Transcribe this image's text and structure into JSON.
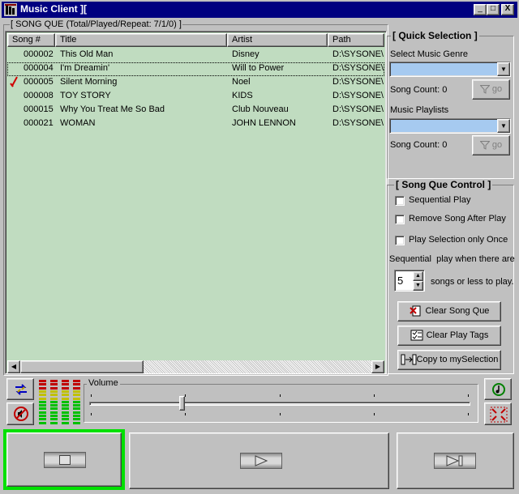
{
  "window": {
    "title": "Music Client ][",
    "controls": {
      "minimize": "_",
      "maximize": "□",
      "close": "X"
    }
  },
  "queue": {
    "legend": "[ SONG QUE (Total/Played/Repeat: 7/1/0) ]",
    "columns": [
      "Song #",
      "Title",
      "Artist",
      "Path"
    ],
    "rows": [
      {
        "num": "000002",
        "title": "This Old Man",
        "artist": "Disney",
        "path": "D:\\SYSONE\\"
      },
      {
        "num": "000004",
        "title": "I'm Dreamin'",
        "artist": "Will to Power",
        "path": "D:\\SYSONE\\"
      },
      {
        "num": "000005",
        "title": "Silent Morning",
        "artist": "Noel",
        "path": "D:\\SYSONE\\"
      },
      {
        "num": "000008",
        "title": "TOY STORY",
        "artist": "KIDS",
        "path": "D:\\SYSONE\\"
      },
      {
        "num": "000015",
        "title": "Why You Treat Me So Bad",
        "artist": "Club Nouveau",
        "path": "D:\\SYSONE\\"
      },
      {
        "num": "000021",
        "title": "WOMAN",
        "artist": "JOHN LENNON",
        "path": "D:\\SYSONE\\"
      }
    ],
    "playing_row": 2,
    "focused_row": 1
  },
  "quick_selection": {
    "legend": "[ Quick Selection ]",
    "genre_label": "Select Music Genre",
    "genre_value": "",
    "genre_count": "Song Count: 0",
    "playlists_label": "Music Playlists",
    "playlist_value": "",
    "playlist_count": "Song Count: 0",
    "go_label": "go"
  },
  "que_control": {
    "legend": "[ Song Que Control ]",
    "sequential_play": "Sequential Play",
    "remove_after_play": "Remove Song After Play",
    "play_once": "Play Selection only Once",
    "seq_text_1": "Sequential  play when there are",
    "seq_value": "5",
    "seq_text_2": "songs or less to play.",
    "clear_que": "Clear Song Que",
    "clear_tags": "Clear Play Tags",
    "copy_selection": "Copy to mySelection"
  },
  "volume": {
    "label": "Volume",
    "level": 0.24
  },
  "colors": {
    "titlebar": "#000080",
    "queue_bg": "#c0dcc0",
    "combo_bg": "#a6caf0",
    "vu_green": "#00c000",
    "vu_yellow": "#c0c000",
    "vu_red": "#c00000",
    "stop_highlight": "#00e000",
    "playing_marker": "#d00000"
  }
}
